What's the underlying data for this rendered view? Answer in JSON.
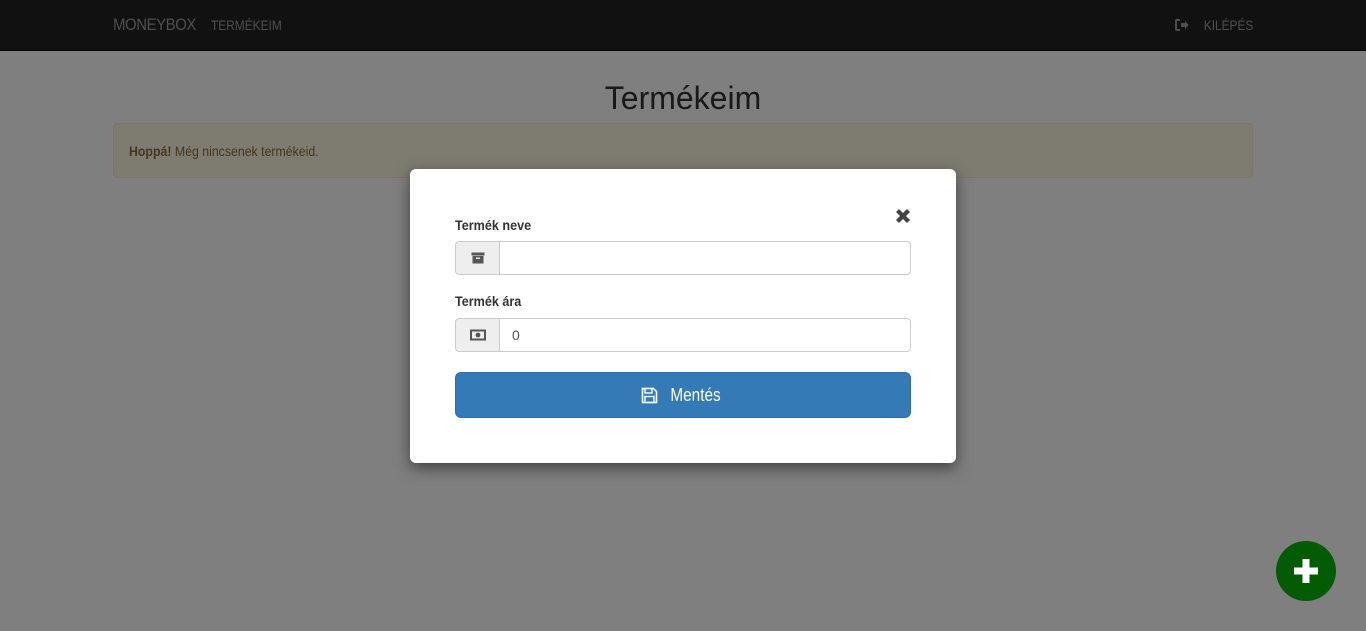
{
  "navbar": {
    "brand": "MONEYBOX",
    "nav_items": [
      {
        "label": "TERMÉKEIM"
      }
    ],
    "logout_label": "KILÉPÉS",
    "logout_icon": "sign-out-icon"
  },
  "main": {
    "title": "Termékeim",
    "alert": {
      "strong": "Hoppá!",
      "text": "Még nincsenek termékeid."
    }
  },
  "modal": {
    "close_icon": "close-icon",
    "fields": [
      {
        "label": "Termék neve",
        "icon": "archive-icon",
        "value": "",
        "placeholder": ""
      },
      {
        "label": "Termék ára",
        "icon": "money-icon",
        "value": "0",
        "placeholder": ""
      }
    ],
    "save_label": "Mentés",
    "save_icon": "floppy-disk-icon"
  },
  "fab": {
    "icon": "plus-icon"
  },
  "colors": {
    "navbar_bg": "#222222",
    "primary": "#337ab7",
    "fab_bg": "#035c03",
    "alert_bg": "#fcf8e3",
    "alert_text": "#8a6d3b"
  }
}
